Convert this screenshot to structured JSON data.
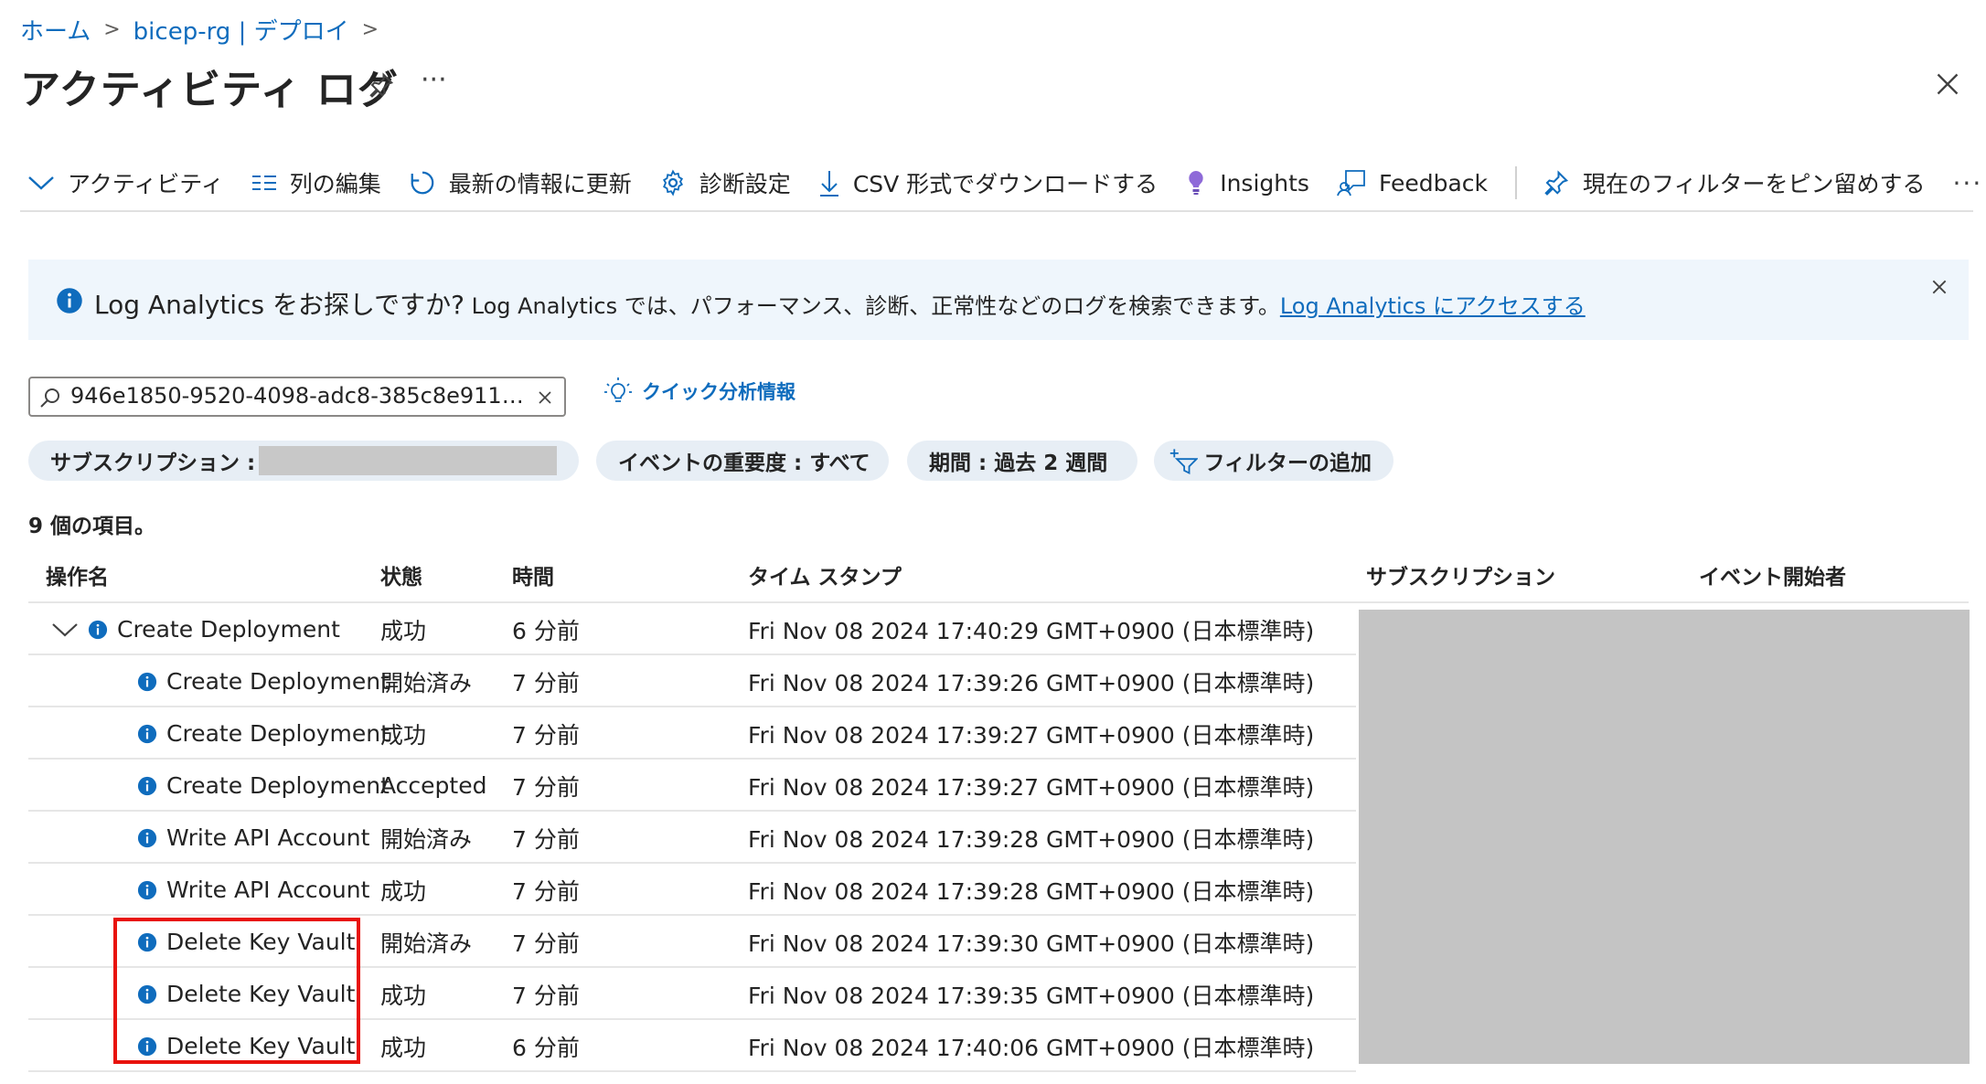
{
  "breadcrumb": {
    "home": "ホーム",
    "parent": "bicep-rg | デプロイ"
  },
  "page_title": "アクティビティ ログ",
  "toolbar": {
    "activity": "アクティビティ",
    "edit_columns": "列の編集",
    "refresh": "最新の情報に更新",
    "diagnostics": "診断設定",
    "download": "CSV 形式でダウンロードする",
    "insights": "Insights",
    "feedback": "Feedback",
    "pin_filter": "現在のフィルターをピン留めする",
    "more": "···"
  },
  "banner": {
    "lead": "Log Analytics をお探しですか?",
    "text": " Log Analytics では、パフォーマンス、診断、正常性などのログを検索できます。",
    "link": "Log Analytics にアクセスする"
  },
  "search": {
    "value": "946e1850-9520-4098-adc8-385c8e911…"
  },
  "quick_insights": "クイック分析情報",
  "filters": {
    "subscription": "サブスクリプション :",
    "severity": "イベントの重要度 : すべて",
    "period": "期間 : 過去 2 週間",
    "add": "フィルターの追加"
  },
  "item_count": "9 個の項目。",
  "table": {
    "headers": {
      "operation": "操作名",
      "status": "状態",
      "time": "時間",
      "timestamp": "タイム スタンプ",
      "subscription": "サブスクリプション",
      "initiator": "イベント開始者"
    },
    "rows": [
      {
        "op": "Create Deployment",
        "status": "成功",
        "time": "6 分前",
        "ts": "Fri Nov 08 2024 17:40:29 GMT+0900 (日本標準時)"
      },
      {
        "op": "Create Deployment",
        "status": "開始済み",
        "time": "7 分前",
        "ts": "Fri Nov 08 2024 17:39:26 GMT+0900 (日本標準時)"
      },
      {
        "op": "Create Deployment",
        "status": "成功",
        "time": "7 分前",
        "ts": "Fri Nov 08 2024 17:39:27 GMT+0900 (日本標準時)"
      },
      {
        "op": "Create Deployment",
        "status": "Accepted",
        "time": "7 分前",
        "ts": "Fri Nov 08 2024 17:39:27 GMT+0900 (日本標準時)"
      },
      {
        "op": "Write API Account",
        "status": "開始済み",
        "time": "7 分前",
        "ts": "Fri Nov 08 2024 17:39:28 GMT+0900 (日本標準時)"
      },
      {
        "op": "Write API Account",
        "status": "成功",
        "time": "7 分前",
        "ts": "Fri Nov 08 2024 17:39:28 GMT+0900 (日本標準時)"
      },
      {
        "op": "Delete Key Vault",
        "status": "開始済み",
        "time": "7 分前",
        "ts": "Fri Nov 08 2024 17:39:30 GMT+0900 (日本標準時)"
      },
      {
        "op": "Delete Key Vault",
        "status": "成功",
        "time": "7 分前",
        "ts": "Fri Nov 08 2024 17:39:35 GMT+0900 (日本標準時)"
      },
      {
        "op": "Delete Key Vault",
        "status": "成功",
        "time": "6 分前",
        "ts": "Fri Nov 08 2024 17:40:06 GMT+0900 (日本標準時)"
      }
    ]
  },
  "colors": {
    "accent": "#0f6cbd",
    "highlight": "#e8120c",
    "redaction": "#c4c4c4"
  },
  "icons": [
    "chevron-right-icon",
    "pin-icon",
    "close-icon",
    "chevron-down-icon",
    "columns-icon",
    "refresh-icon",
    "gear-icon",
    "download-icon",
    "lightbulb-icon",
    "feedback-icon",
    "info-icon",
    "search-icon",
    "filter-add-icon"
  ]
}
